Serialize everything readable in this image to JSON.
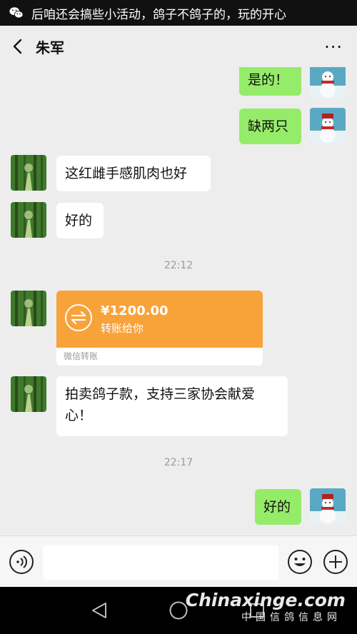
{
  "notification": {
    "icon": "wechat-icon",
    "text": "后咱还会搞些小活动，鸽子不鸽子的，玩的开心"
  },
  "header": {
    "title": "朱军",
    "more_label": "···"
  },
  "messages": [
    {
      "side": "me",
      "text": "是的！"
    },
    {
      "side": "me",
      "text": "缺两只"
    },
    {
      "side": "other",
      "text": "这红雌手感肌肉也好"
    },
    {
      "side": "other",
      "text": "好的"
    },
    {
      "type": "timestamp",
      "text": "22:12"
    },
    {
      "type": "transfer",
      "amount": "¥1200.00",
      "desc": "转账给你",
      "footer": "微信转账"
    },
    {
      "side": "other",
      "text": "拍卖鸽子款，支持三家协会献爱心！"
    },
    {
      "type": "timestamp",
      "text": "22:17"
    },
    {
      "side": "me",
      "text": "好的"
    }
  ],
  "watermark": {
    "line1": "Chinaxinge.com",
    "line2": "中国信鸽信息网"
  },
  "colors": {
    "me_bubble": "#95ec69",
    "other_bubble": "#ffffff",
    "transfer": "#f8a23a",
    "background": "#ededed"
  }
}
